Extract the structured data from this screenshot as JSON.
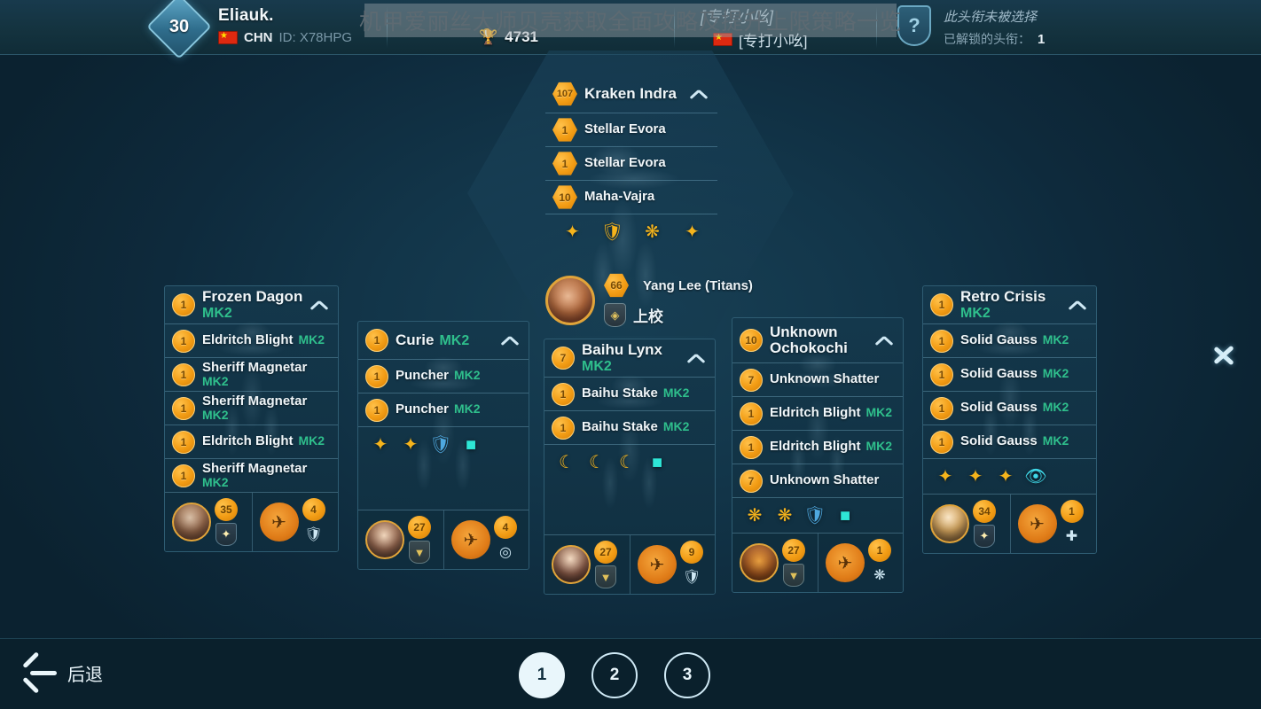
{
  "header": {
    "level": "30",
    "player_name": "Eliauk.",
    "country_code": "CHN",
    "player_id": "ID: X78HPG",
    "trophy_icon": "trophy-icon",
    "trophy_count": "4731",
    "clan_name": "[专打小吆]",
    "clan_tag": "[专打小吆]",
    "badge_glyph": "?",
    "title_status": "此头衔未被选择",
    "titles_unlocked_label": "已解锁的头衔：",
    "titles_unlocked_count": "1"
  },
  "watermark": "机甲爱丽丝大师贝壳获取全面攻略及提升上限策略一览",
  "center_pilot": {
    "level": "66",
    "name": "Yang Lee (Titans)",
    "rank": "上校"
  },
  "cards": [
    {
      "id": "frozen-dagon",
      "title": "Frozen Dagon",
      "title_mk": "MK2",
      "title_level": "1",
      "items": [
        {
          "level": "1",
          "name": "Eldritch Blight",
          "mk": "MK2",
          "inline": true
        },
        {
          "level": "1",
          "name": "Sheriff Magnetar",
          "mk": "MK2",
          "inline": false
        },
        {
          "level": "1",
          "name": "Sheriff Magnetar",
          "mk": "MK2",
          "inline": false
        },
        {
          "level": "1",
          "name": "Eldritch Blight",
          "mk": "MK2",
          "inline": true
        },
        {
          "level": "1",
          "name": "Sheriff Magnetar",
          "mk": "MK2",
          "inline": false
        }
      ],
      "modules": [],
      "pilot": {
        "level": "35",
        "rank_icon": "medal-icon",
        "portrait": "p-male1"
      },
      "drone": {
        "level": "4",
        "equip_icon": "shield-drone-icon"
      }
    },
    {
      "id": "curie",
      "title": "Curie",
      "title_mk": "MK2",
      "title_level": "1",
      "items": [
        {
          "level": "1",
          "name": "Puncher",
          "mk": "MK2",
          "inline": true
        },
        {
          "level": "1",
          "name": "Puncher",
          "mk": "MK2",
          "inline": true
        }
      ],
      "modules": [
        {
          "icon": "damage-boost-icon",
          "color": "gold"
        },
        {
          "icon": "damage-boost-icon",
          "color": "gold"
        },
        {
          "icon": "shield-up-icon",
          "color": "blue"
        },
        {
          "icon": "energy-cell-icon",
          "color": "cyan"
        }
      ],
      "pilot": {
        "level": "27",
        "rank_icon": "chevron-rank-icon",
        "portrait": "p-f1"
      },
      "drone": {
        "level": "4",
        "equip_icon": "targeting-icon"
      }
    },
    {
      "id": "baihu-lynx",
      "title": "Baihu Lynx",
      "title_mk": "MK2",
      "title_level": "7",
      "items": [
        {
          "level": "1",
          "name": "Baihu Stake",
          "mk": "MK2",
          "inline": true
        },
        {
          "level": "1",
          "name": "Baihu Stake",
          "mk": "MK2",
          "inline": true
        }
      ],
      "modules": [
        {
          "icon": "crescent-boost-icon",
          "color": "gold"
        },
        {
          "icon": "crescent-boost-icon",
          "color": "gold"
        },
        {
          "icon": "crescent-boost-icon",
          "color": "gold"
        },
        {
          "icon": "energy-cell-icon",
          "color": "cyan"
        }
      ],
      "pilot": {
        "level": "27",
        "rank_icon": "chevron-rank-icon",
        "portrait": "p-f2"
      },
      "drone": {
        "level": "9",
        "equip_icon": "shield-drone-icon"
      }
    },
    {
      "id": "unknown-ochokochi",
      "title": "Unknown Ochokochi",
      "title_mk": "",
      "title_level": "10",
      "items": [
        {
          "level": "7",
          "name": "Unknown Shatter",
          "mk": "",
          "inline": true
        },
        {
          "level": "1",
          "name": "Eldritch Blight",
          "mk": "MK2",
          "inline": true
        },
        {
          "level": "1",
          "name": "Eldritch Blight",
          "mk": "MK2",
          "inline": true
        },
        {
          "level": "7",
          "name": "Unknown Shatter",
          "mk": "",
          "inline": true
        }
      ],
      "modules": [
        {
          "icon": "burst-damage-icon",
          "color": "gold"
        },
        {
          "icon": "burst-damage-icon",
          "color": "gold"
        },
        {
          "icon": "shield-up-icon",
          "color": "blue"
        },
        {
          "icon": "energy-cell-icon",
          "color": "cyan"
        }
      ],
      "pilot": {
        "level": "27",
        "rank_icon": "chevron-rank-icon",
        "portrait": "p-tiger"
      },
      "drone": {
        "level": "1",
        "equip_icon": "burst-drone-icon"
      }
    },
    {
      "id": "retro-crisis",
      "title": "Retro Crisis",
      "title_mk": "MK2",
      "title_level": "1",
      "items": [
        {
          "level": "1",
          "name": "Solid Gauss",
          "mk": "MK2",
          "inline": true
        },
        {
          "level": "1",
          "name": "Solid Gauss",
          "mk": "MK2",
          "inline": true
        },
        {
          "level": "1",
          "name": "Solid Gauss",
          "mk": "MK2",
          "inline": true
        },
        {
          "level": "1",
          "name": "Solid Gauss",
          "mk": "MK2",
          "inline": true
        }
      ],
      "modules": [
        {
          "icon": "damage-boost-icon",
          "color": "gold"
        },
        {
          "icon": "damage-boost-icon",
          "color": "gold"
        },
        {
          "icon": "damage-boost-icon",
          "color": "gold"
        },
        {
          "icon": "eye-stealth-icon",
          "color": "eye"
        }
      ],
      "pilot": {
        "level": "34",
        "rank_icon": "medal-icon",
        "portrait": "p-f3"
      },
      "drone": {
        "level": "1",
        "equip_icon": "repair-drone-icon"
      }
    }
  ],
  "center_card": {
    "id": "kraken-indra",
    "title": "Kraken Indra",
    "title_level": "107",
    "items": [
      {
        "level": "1",
        "name": "Stellar Evora",
        "mk": ""
      },
      {
        "level": "1",
        "name": "Stellar Evora",
        "mk": ""
      },
      {
        "level": "10",
        "name": "Maha-Vajra",
        "mk": ""
      }
    ],
    "modules": [
      {
        "icon": "damage-boost-icon",
        "color": "gold"
      },
      {
        "icon": "shield-boost-icon",
        "color": "gold"
      },
      {
        "icon": "burst-damage-icon",
        "color": "gold"
      },
      {
        "icon": "damage-boost-icon",
        "color": "gold"
      }
    ]
  },
  "nav": {
    "next_icon": "chevron-right-icon"
  },
  "bottom": {
    "back_label": "后退",
    "back_icon": "arrow-left-icon",
    "pages": [
      {
        "label": "1",
        "active": true
      },
      {
        "label": "2",
        "active": false
      },
      {
        "label": "3",
        "active": false
      }
    ]
  },
  "colors": {
    "accent_gold": "#f29c14",
    "accent_green": "#2fbf8c",
    "accent_cyan": "#2ee6d6",
    "bg_deep": "#0c2230",
    "panel": "#143848"
  }
}
